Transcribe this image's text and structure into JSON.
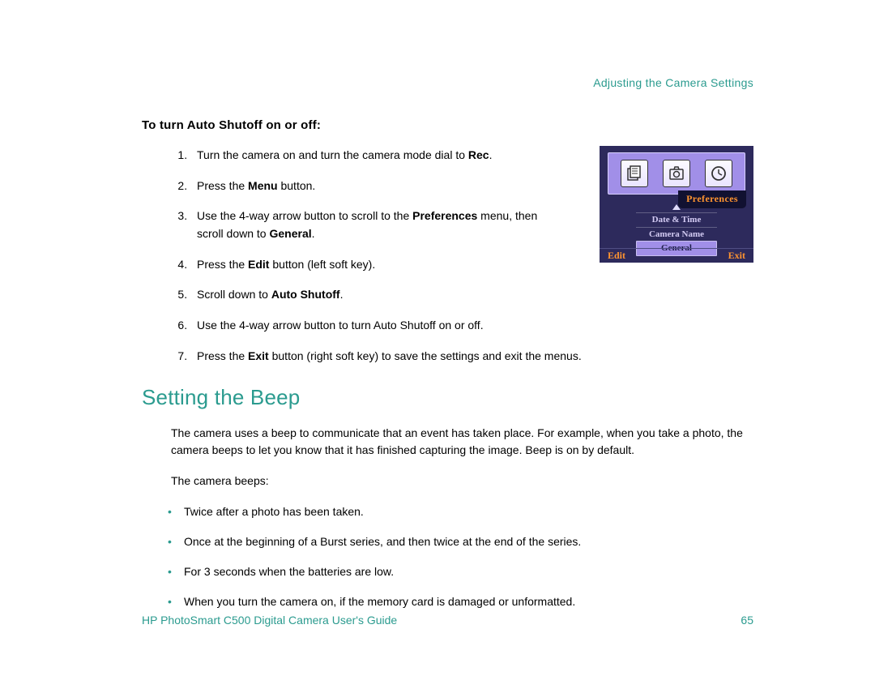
{
  "header": {
    "section_title": "Adjusting the Camera Settings"
  },
  "subheading": "To turn Auto Shutoff on or off:",
  "steps": {
    "s1a": "Turn the camera on and turn the camera mode dial to ",
    "s1b": "Rec",
    "s1c": ".",
    "s2a": "Press the ",
    "s2b": "Menu",
    "s2c": " button.",
    "s3a": "Use the 4-way arrow button to scroll to the ",
    "s3b": "Preferences",
    "s3c": " menu, then scroll down to ",
    "s3d": "General",
    "s3e": ".",
    "s4a": "Press the ",
    "s4b": "Edit",
    "s4c": " button (left soft key).",
    "s5a": "Scroll down to ",
    "s5b": "Auto Shutoff",
    "s5c": ".",
    "s6": "Use the 4-way arrow button to turn Auto Shutoff on or off.",
    "s7a": "Press the ",
    "s7b": "Exit",
    "s7c": " button (right soft key) to save the settings and exit the menus."
  },
  "screenshot": {
    "tab": "Preferences",
    "row1": "Date & Time",
    "row2": "Camera Name",
    "row3": "General",
    "left_soft": "Edit",
    "right_soft": "Exit"
  },
  "section2": {
    "heading": "Setting the Beep",
    "para1": "The camera uses a beep to communicate that an event has taken place. For example, when you take a photo, the camera beeps to let you know that it has finished capturing the image. Beep is on by default.",
    "para2": "The camera beeps:",
    "bullets": {
      "b1": "Twice after a photo has been taken.",
      "b2": "Once at the beginning of a Burst series, and then twice at the end of the series.",
      "b3": "For 3 seconds when the batteries are low.",
      "b4": "When you turn the camera on, if the memory card is damaged or unformatted."
    }
  },
  "footer": {
    "left": "HP PhotoSmart C500 Digital Camera User's Guide",
    "page": "65"
  }
}
